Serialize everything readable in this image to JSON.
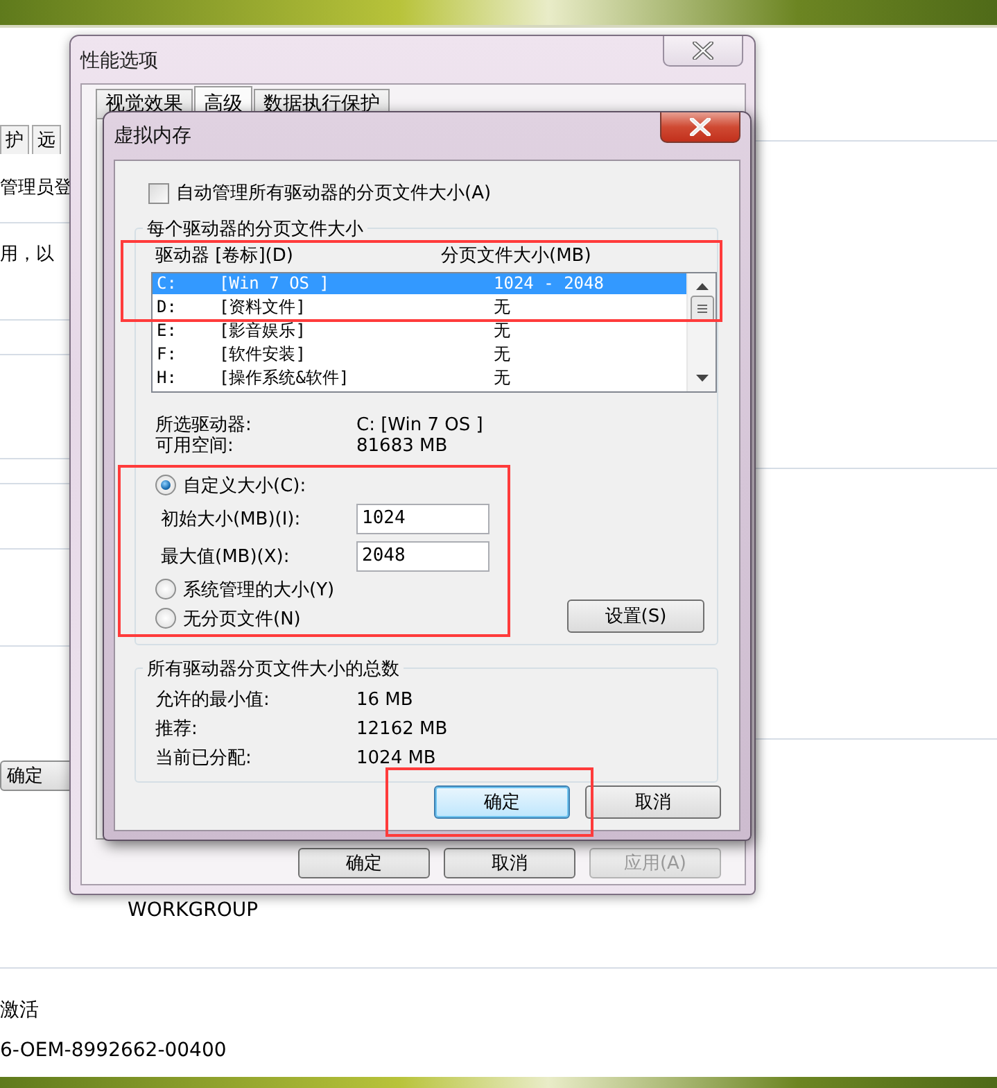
{
  "background_window": {
    "tabs": [
      {
        "label": "护",
        "selected": false
      },
      {
        "label": "远",
        "selected": false
      }
    ],
    "texts": [
      "管理员登",
      "用，以"
    ],
    "ok_button": "确定",
    "workgroup": "WORKGROUP",
    "activation": "激活",
    "product_id": "6-OEM-8992662-00400"
  },
  "performance_options": {
    "title": "性能选项",
    "tabs": [
      {
        "label": "视觉效果",
        "selected": false
      },
      {
        "label": "高级",
        "selected": true
      },
      {
        "label": "数据执行保护",
        "selected": false
      }
    ],
    "buttons": [
      {
        "label": "确定",
        "disabled": false
      },
      {
        "label": "取消",
        "disabled": false
      },
      {
        "label": "应用(A)",
        "disabled": true
      }
    ]
  },
  "virtual_memory": {
    "title": "虚拟内存",
    "auto_manage": {
      "label": "自动管理所有驱动器的分页文件大小(A)",
      "checked": false
    },
    "drives_group": {
      "title": "每个驱动器的分页文件大小",
      "highlighted": true,
      "columns": [
        "驱动器 [卷标](D)",
        "分页文件大小(MB)"
      ],
      "drives": [
        {
          "drive": "C:",
          "label": "[Win 7 OS ]",
          "size": "1024 - 2048",
          "selected": true
        },
        {
          "drive": "D:",
          "label": "[资料文件]",
          "size": "无",
          "selected": false
        },
        {
          "drive": "E:",
          "label": "[影音娱乐]",
          "size": "无",
          "selected": false
        },
        {
          "drive": "F:",
          "label": "[软件安装]",
          "size": "无",
          "selected": false
        },
        {
          "drive": "H:",
          "label": "[操作系统&软件]",
          "size": "无",
          "selected": false
        }
      ]
    },
    "selected_drive": {
      "label": "所选驱动器:",
      "value": "C:  [Win 7 OS ]"
    },
    "free_space": {
      "label": "可用空间:",
      "value": "81683 MB"
    },
    "size_options": {
      "highlighted": true,
      "radios": [
        {
          "label": "自定义大小(C):",
          "selected": true
        },
        {
          "label": "系统管理的大小(Y)",
          "selected": false
        },
        {
          "label": "无分页文件(N)",
          "selected": false
        }
      ],
      "initial_size": {
        "label": "初始大小(MB)(I):",
        "value": "1024"
      },
      "max_size": {
        "label": "最大值(MB)(X):",
        "value": "2048"
      }
    },
    "settings_button": "设置(S)",
    "totals": {
      "title": "所有驱动器分页文件大小的总数",
      "rows": [
        {
          "label": "允许的最小值:",
          "value": "16 MB"
        },
        {
          "label": "推荐:",
          "value": "12162 MB"
        },
        {
          "label": "当前已分配:",
          "value": "1024 MB"
        }
      ]
    },
    "buttons": [
      {
        "label": "确定",
        "default": true,
        "highlighted": true
      },
      {
        "label": "取消",
        "default": false,
        "highlighted": false
      }
    ]
  }
}
